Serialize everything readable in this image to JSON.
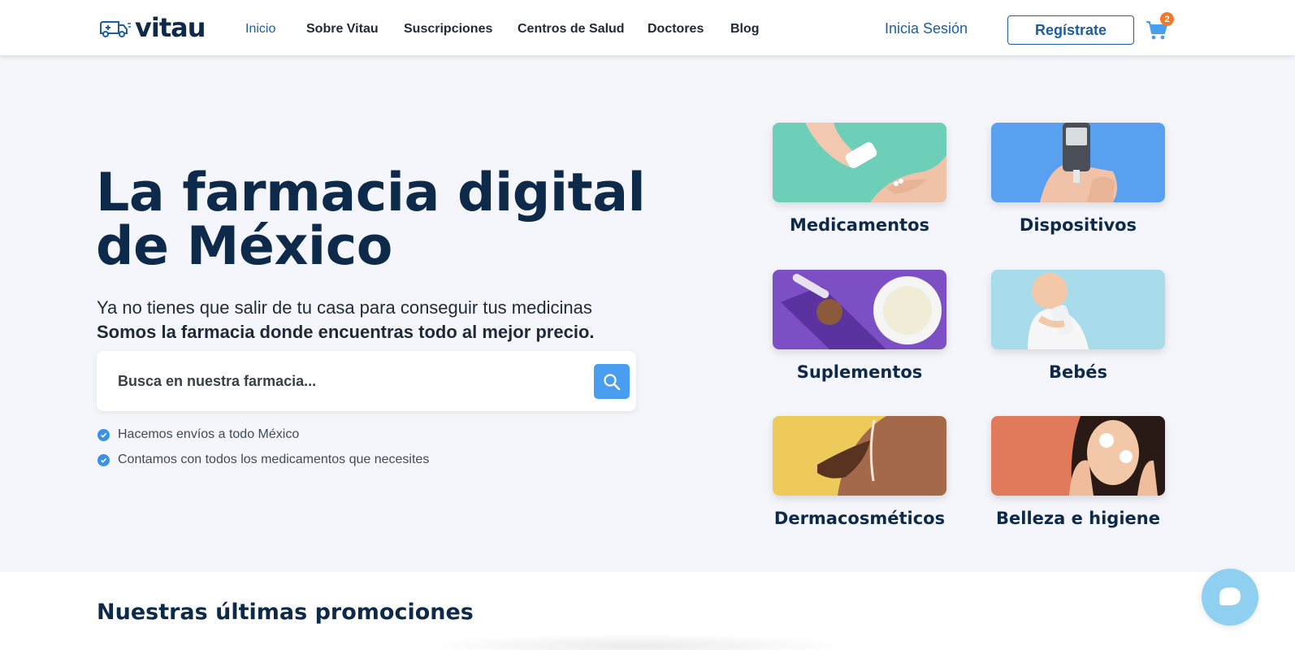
{
  "header": {
    "logo_text": "vitau",
    "nav": [
      {
        "label": "Inicio",
        "active": true
      },
      {
        "label": "Sobre Vitau",
        "active": false
      },
      {
        "label": "Suscripciones",
        "active": false
      },
      {
        "label": "Centros de Salud",
        "active": false
      },
      {
        "label": "Doctores",
        "active": false
      },
      {
        "label": "Blog",
        "active": false
      }
    ],
    "login_label": "Inicia Sesión",
    "register_label": "Regístrate",
    "cart_count": "2",
    "cart_icon": "shopping-cart-icon"
  },
  "hero": {
    "title_line1": "La farmacia digital",
    "title_line2": "de México",
    "subtitle": "Ya no tienes que salir de tu casa para conseguir tus medicinas",
    "subtitle_bold": "Somos la farmacia donde encuentras todo al mejor precio.",
    "search_placeholder": "Busca en nuestra farmacia...",
    "search_icon": "search-icon",
    "features": [
      "Hacemos envíos a todo México",
      "Contamos con todos los medicamentos que necesites"
    ]
  },
  "categories": [
    {
      "label": "Medicamentos",
      "color": "#6ecfb8"
    },
    {
      "label": "Dispositivos",
      "color": "#5aa0f0"
    },
    {
      "label": "Suplementos",
      "color": "#7c4fc4"
    },
    {
      "label": "Bebés",
      "color": "#a9dceb"
    },
    {
      "label": "Dermacosméticos",
      "color": "#edca5a"
    },
    {
      "label": "Belleza e higiene",
      "color": "#e07a5a"
    }
  ],
  "promotions": {
    "title": "Nuestras últimas promociones"
  },
  "colors": {
    "brand_dark": "#0e2a4a",
    "brand_blue": "#1c5ea0",
    "accent": "#4a9ef0",
    "badge": "#f2782a"
  }
}
